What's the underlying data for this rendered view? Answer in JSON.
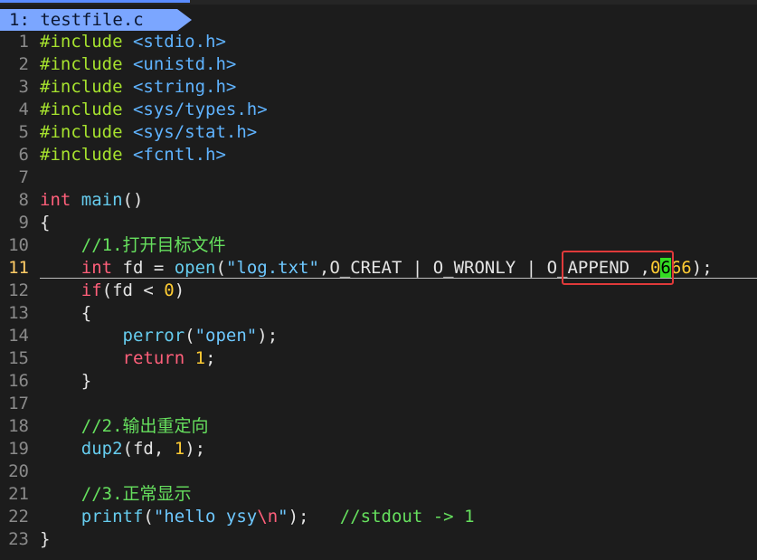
{
  "window": {
    "tab_label": "1: testfile.c",
    "accent": "#7ba6ff",
    "selection_box_color": "#e03a3a"
  },
  "editor": {
    "current_line": 11,
    "lines": [
      {
        "no": "1",
        "parts": [
          [
            "pre",
            "#include "
          ],
          [
            "inc",
            "<stdio.h>"
          ]
        ]
      },
      {
        "no": "2",
        "parts": [
          [
            "pre",
            "#include "
          ],
          [
            "inc",
            "<unistd.h>"
          ]
        ]
      },
      {
        "no": "3",
        "parts": [
          [
            "pre",
            "#include "
          ],
          [
            "inc",
            "<string.h>"
          ]
        ]
      },
      {
        "no": "4",
        "parts": [
          [
            "pre",
            "#include "
          ],
          [
            "inc",
            "<sys/types.h>"
          ]
        ]
      },
      {
        "no": "5",
        "parts": [
          [
            "pre",
            "#include "
          ],
          [
            "inc",
            "<sys/stat.h>"
          ]
        ]
      },
      {
        "no": "6",
        "parts": [
          [
            "pre",
            "#include "
          ],
          [
            "inc",
            "<fcntl.h>"
          ]
        ]
      },
      {
        "no": "7",
        "parts": []
      },
      {
        "no": "8",
        "parts": [
          [
            "kw",
            "int"
          ],
          [
            "op",
            " "
          ],
          [
            "fn",
            "main"
          ],
          [
            "op",
            "()"
          ]
        ]
      },
      {
        "no": "9",
        "parts": [
          [
            "op",
            "{"
          ]
        ]
      },
      {
        "no": "10",
        "parts": [
          [
            "op",
            "    "
          ],
          [
            "cm",
            "//1.打开目标文件"
          ]
        ]
      },
      {
        "no": "11",
        "parts": [
          [
            "op",
            "    "
          ],
          [
            "kw",
            "int"
          ],
          [
            "op",
            " fd = "
          ],
          [
            "fn",
            "open"
          ],
          [
            "op",
            "("
          ],
          [
            "str",
            "\"log.txt\""
          ],
          [
            "op",
            ",O_CREAT | O_WRONLY | O_APPEND ,"
          ],
          [
            "num",
            "0"
          ],
          [
            "hl",
            "6"
          ],
          [
            "num",
            "66"
          ],
          [
            "op",
            ");"
          ]
        ]
      },
      {
        "no": "12",
        "parts": [
          [
            "op",
            "    "
          ],
          [
            "kw",
            "if"
          ],
          [
            "op",
            "(fd < "
          ],
          [
            "num",
            "0"
          ],
          [
            "op",
            ")"
          ]
        ]
      },
      {
        "no": "13",
        "parts": [
          [
            "op",
            "    {"
          ]
        ]
      },
      {
        "no": "14",
        "parts": [
          [
            "op",
            "        "
          ],
          [
            "fn",
            "perror"
          ],
          [
            "op",
            "("
          ],
          [
            "str",
            "\"open\""
          ],
          [
            "op",
            ");"
          ]
        ]
      },
      {
        "no": "15",
        "parts": [
          [
            "op",
            "        "
          ],
          [
            "kw",
            "return"
          ],
          [
            "op",
            " "
          ],
          [
            "num",
            "1"
          ],
          [
            "op",
            ";"
          ]
        ]
      },
      {
        "no": "16",
        "parts": [
          [
            "op",
            "    }"
          ]
        ]
      },
      {
        "no": "17",
        "parts": []
      },
      {
        "no": "18",
        "parts": [
          [
            "op",
            "    "
          ],
          [
            "cm",
            "//2.输出重定向"
          ]
        ]
      },
      {
        "no": "19",
        "parts": [
          [
            "op",
            "    "
          ],
          [
            "fn",
            "dup2"
          ],
          [
            "op",
            "(fd, "
          ],
          [
            "num",
            "1"
          ],
          [
            "op",
            ");"
          ]
        ]
      },
      {
        "no": "20",
        "parts": []
      },
      {
        "no": "21",
        "parts": [
          [
            "op",
            "    "
          ],
          [
            "cm",
            "//3.正常显示"
          ]
        ]
      },
      {
        "no": "22",
        "parts": [
          [
            "op",
            "    "
          ],
          [
            "fn",
            "printf"
          ],
          [
            "op",
            "("
          ],
          [
            "str",
            "\"hello ysy"
          ],
          [
            "esc",
            "\\n"
          ],
          [
            "str",
            "\""
          ],
          [
            "op",
            ");   "
          ],
          [
            "cm",
            "//stdout -> 1"
          ]
        ]
      },
      {
        "no": "23",
        "parts": [
          [
            "op",
            "}"
          ]
        ]
      }
    ]
  }
}
